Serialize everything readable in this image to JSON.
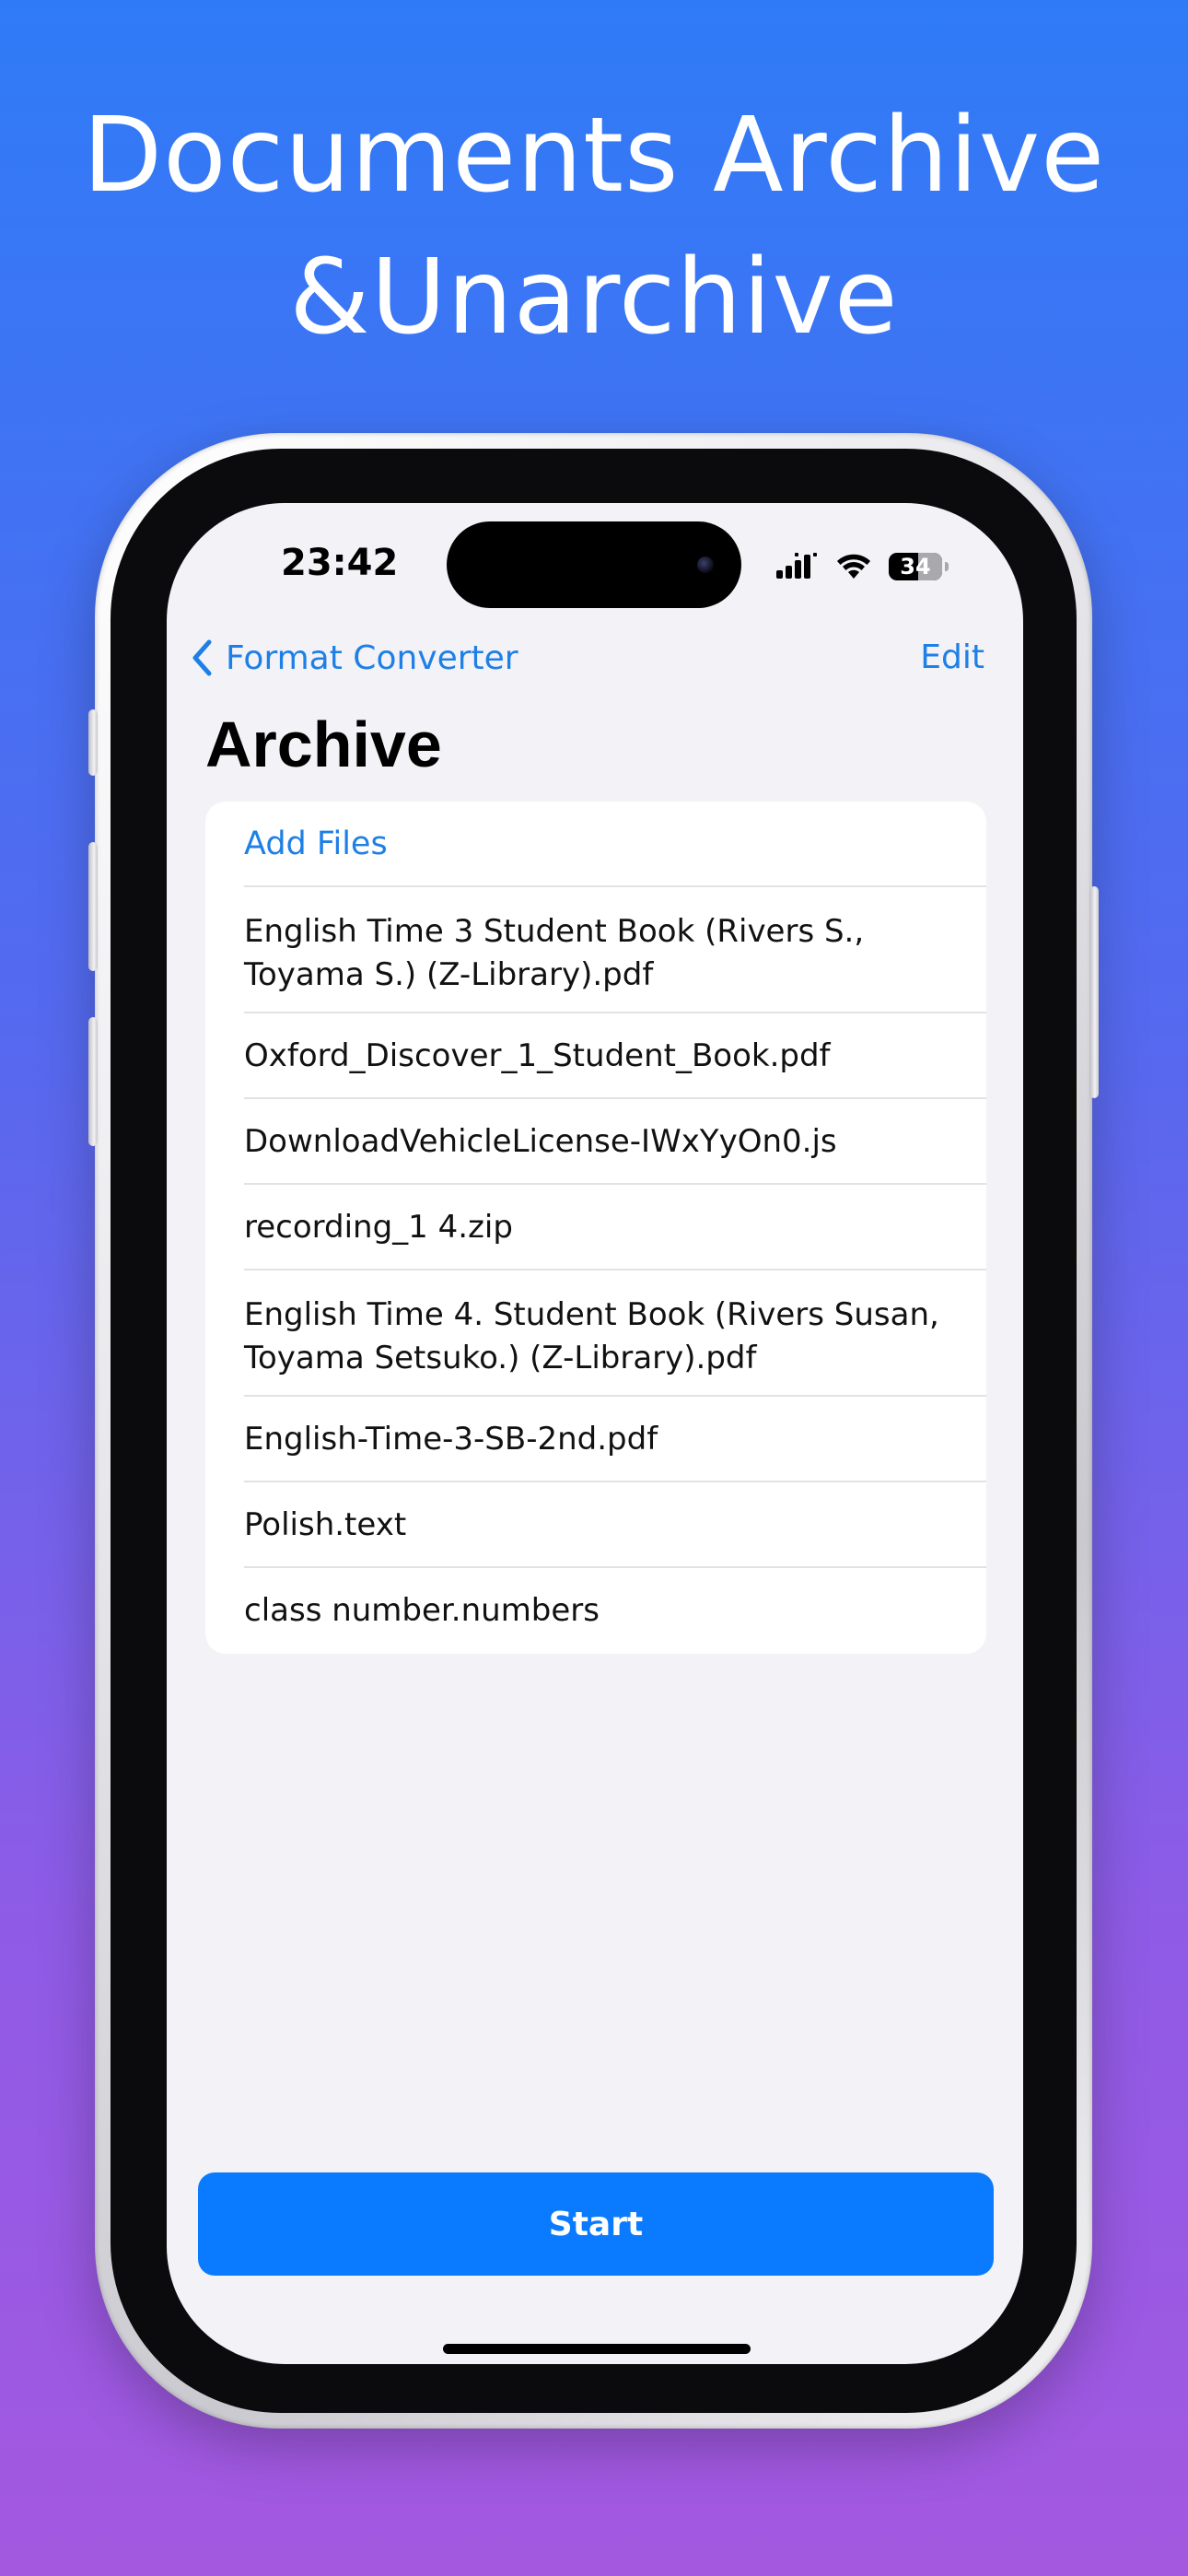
{
  "headline": {
    "line1": "Documents Archive",
    "line2": "&Unarchive"
  },
  "status_bar": {
    "time": "23:42",
    "battery": "34"
  },
  "nav": {
    "back_label": "Format Converter",
    "edit_label": "Edit"
  },
  "page": {
    "title": "Archive"
  },
  "list": {
    "add_files_label": "Add Files",
    "files": [
      "English Time 3 Student Book (Rivers S., Toyama S.) (Z-Library).pdf",
      "Oxford_Discover_1_Student_Book.pdf",
      "DownloadVehicleLicense-IWxYyOn0.js",
      "recording_1 4.zip",
      "English Time 4. Student Book (Rivers Susan, Toyama Setsuko.) (Z-Library).pdf",
      "English-Time-3-SB-2nd.pdf",
      "Polish.text",
      "class number.numbers"
    ]
  },
  "actions": {
    "start_label": "Start"
  },
  "colors": {
    "accent": "#0a7bff",
    "link": "#1e7fe6",
    "gradient_top": "#2f7bf7",
    "gradient_bottom": "#a458e0",
    "screen_bg": "#f2f2f7"
  },
  "icons": {
    "back": "chevron-left-icon",
    "signal": "cellular-signal-icon",
    "wifi": "wifi-icon",
    "battery": "battery-icon"
  }
}
